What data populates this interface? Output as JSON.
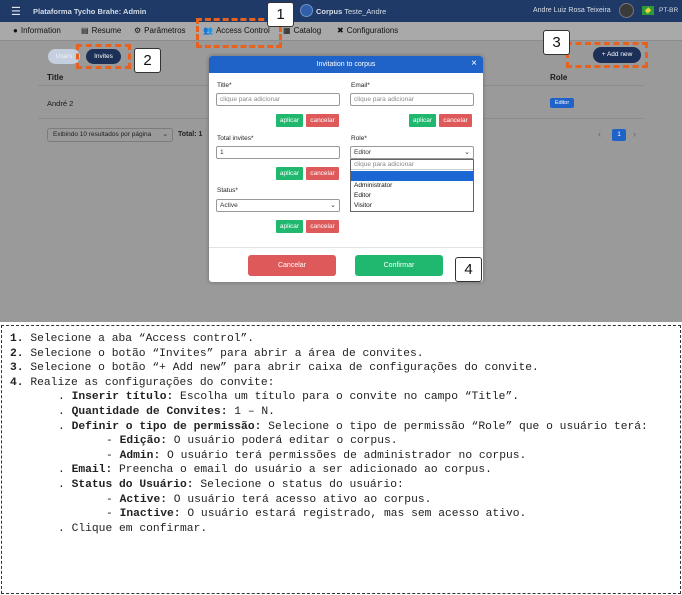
{
  "topbar": {
    "menu_icon": "hamburger-icon",
    "app_name": "Plataforma Tycho Brahe: Admin",
    "corpus_label": "Corpus",
    "corpus_name": "Teste_Andre",
    "user_name": "Andre Luiz Rosa Teixeira",
    "language": "PT-BR"
  },
  "tabs": [
    {
      "label": "Information",
      "icon": "info-icon"
    },
    {
      "label": "Resume",
      "icon": "file-icon"
    },
    {
      "label": "Parâmetros",
      "icon": "sliders-icon"
    },
    {
      "label": "Access Control",
      "icon": "users-icon"
    },
    {
      "label": "Catalog",
      "icon": "catalog-icon"
    },
    {
      "label": "Configurations",
      "icon": "tools-icon"
    }
  ],
  "content": {
    "pill_users": "Users",
    "pill_invites": "Invites",
    "add_new": "+ Add new",
    "col_title": "Title",
    "col_role": "Role",
    "row_name": "André 2",
    "row_role": "Editor",
    "per_page": "Exibindo 10 resultados por página",
    "total": "Total: 1",
    "pager_prev": "‹",
    "pager_current": "1",
    "pager_next": "›"
  },
  "modal": {
    "title": "Invitation to corpus",
    "close": "×",
    "title_label": "Title*",
    "title_placeholder": "clique para adicionar",
    "email_label": "Email*",
    "email_placeholder": "clique para adicionar",
    "apply": "aplicar",
    "cancel_small": "cancelar",
    "total_invites_label": "Total invites*",
    "total_invites_value": "1",
    "role_label": "Role*",
    "role_value": "Editor",
    "role_options": [
      "clique para adicionar",
      "",
      "Administrator",
      "Editor",
      "Visitor"
    ],
    "status_label": "Status*",
    "status_value": "Active",
    "cancel": "Cancelar",
    "confirm": "Confirmar"
  },
  "markers": [
    "1",
    "2",
    "3",
    "4"
  ],
  "colors": {
    "topbar": "#1f3a66",
    "primary": "#1f63c9",
    "apply": "#1fb86e",
    "cancel": "#de5a5a",
    "highlight": "#e8621f"
  },
  "instructions": {
    "s1_num": "1.",
    "s1_text": " Selecione a aba “Access control”.",
    "s2_num": "2.",
    "s2_text": " Selecione o botão “Invites” para abrir a área de convites.",
    "s3_num": "3.",
    "s3_text": " Selecione o botão “+ Add new” para abrir caixa de configurações do convite.",
    "s4_num": "4.",
    "s4_text": " Realize as configurações do convite:",
    "title_key": "Inserir título:",
    "title_text": " Escolha um título para o convite no campo “Title”.",
    "qty_key": "Quantidade de Convites:",
    "qty_text": " 1 – N.",
    "perm_key": "Definir o tipo de permissão:",
    "perm_text": " Selecione o tipo de permissão “Role” que o usuário terá:",
    "edit_key": "Edição:",
    "edit_text": " O usuário poderá editar o corpus.",
    "admin_key": "Admin:",
    "admin_text": " O usuário terá permissões de administrador no corpus.",
    "email_key": "Email:",
    "email_text": " Preencha o email do usuário a ser adicionado ao corpus.",
    "status_key": "Status do Usuário:",
    "status_text": " Selecione o status do usuário:",
    "active_key": "Active:",
    "active_text": " O usuário terá acesso ativo ao corpus.",
    "inactive_key": "Inactive:",
    "inactive_text": " O usuário estará registrado, mas sem acesso ativo.",
    "confirm_text": "Clique em confirmar."
  }
}
